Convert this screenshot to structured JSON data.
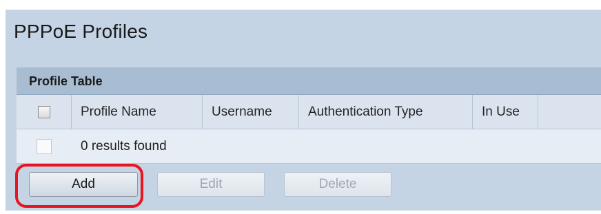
{
  "page": {
    "title": "PPPoE Profiles"
  },
  "table": {
    "title": "Profile Table",
    "columns": [
      "Profile Name",
      "Username",
      "Authentication Type",
      "In Use"
    ],
    "empty_message": "0 results found"
  },
  "buttons": {
    "add": "Add",
    "edit": "Edit",
    "delete": "Delete"
  },
  "colors": {
    "background": "#c4d4e4",
    "header": "#a9bdd2",
    "highlight": "#e8141e"
  }
}
